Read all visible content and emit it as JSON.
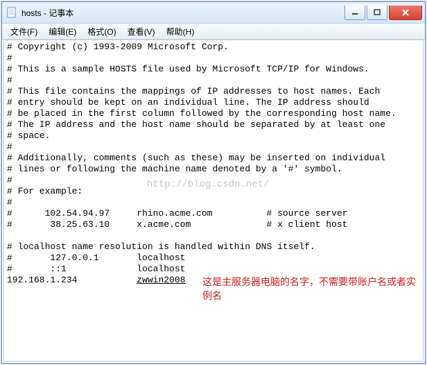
{
  "title": "hosts - 记事本",
  "menu": {
    "file": "文件(F)",
    "edit": "编辑(E)",
    "format": "格式(O)",
    "view": "查看(V)",
    "help": "帮助(H)"
  },
  "content": {
    "lines": [
      "# Copyright (c) 1993-2009 Microsoft Corp.",
      "#",
      "# This is a sample HOSTS file used by Microsoft TCP/IP for Windows.",
      "#",
      "# This file contains the mappings of IP addresses to host names. Each",
      "# entry should be kept on an individual line. The IP address should",
      "# be placed in the first column followed by the corresponding host name.",
      "# The IP address and the host name should be separated by at least one",
      "# space.",
      "#",
      "# Additionally, comments (such as these) may be inserted on individual",
      "# lines or following the machine name denoted by a '#' symbol.",
      "#",
      "# For example:",
      "#",
      "#      102.54.94.97     rhino.acme.com          # source server",
      "#       38.25.63.10     x.acme.com              # x client host",
      "",
      "# localhost name resolution is handled within DNS itself.",
      "#       127.0.0.1       localhost",
      "#       ::1             localhost",
      "192.168.1.234           "
    ],
    "underlined_host": "zwwin2008"
  },
  "watermark": "http://blog.csdn.net/",
  "annotation": "这是主服务器电脑的名字，不需要带账户名或者实例名"
}
